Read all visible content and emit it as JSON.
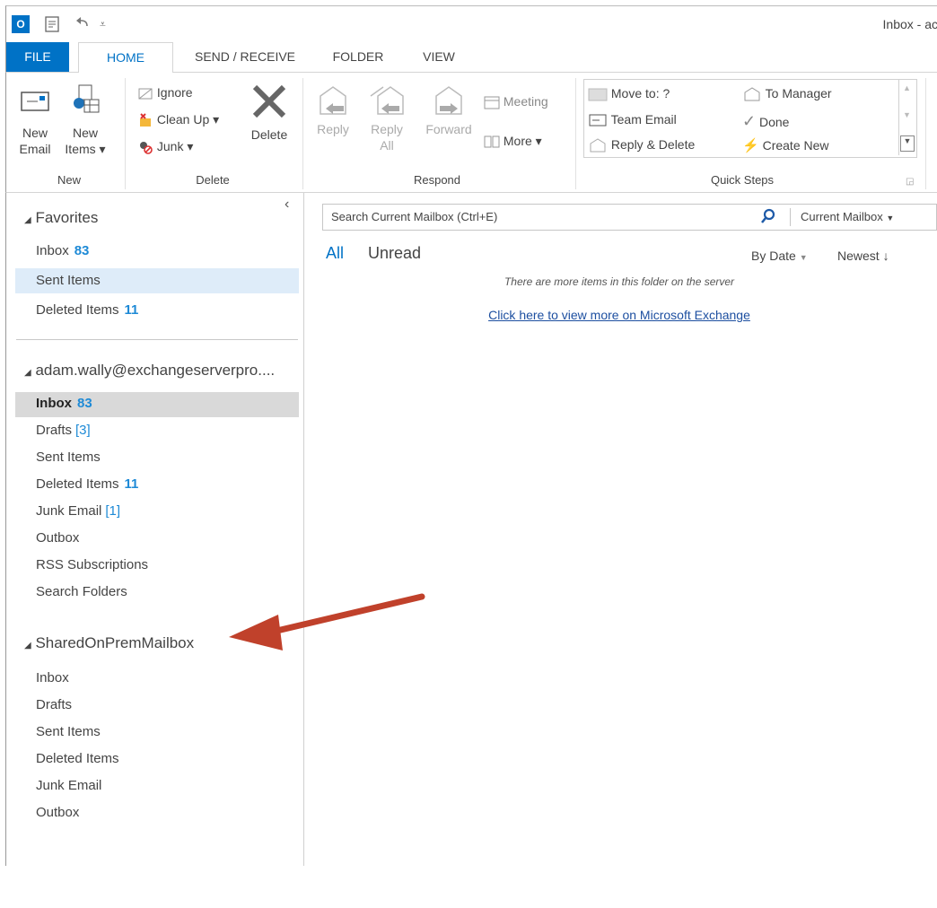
{
  "window": {
    "title": "Inbox - ac"
  },
  "quick_access": {
    "app_icon": "outlook-icon",
    "app_letter": "O",
    "send_receive_icon": "send-receive-icon",
    "undo_icon": "undo-icon",
    "customize_icon": "customize-icon"
  },
  "tabs": [
    {
      "label": "FILE"
    },
    {
      "label": "HOME"
    },
    {
      "label": "SEND / RECEIVE"
    },
    {
      "label": "FOLDER"
    },
    {
      "label": "VIEW"
    }
  ],
  "ribbon": {
    "new": {
      "new_email": "New\nEmail",
      "new_items": "New\nItems ▾",
      "group": "New"
    },
    "delete": {
      "ignore": "Ignore",
      "clean_up": "Clean Up ▾",
      "junk": "Junk ▾",
      "delete": "Delete",
      "group": "Delete"
    },
    "respond": {
      "reply": "Reply",
      "reply_all": "Reply\nAll",
      "forward": "Forward",
      "meeting": "Meeting",
      "more": "More ▾",
      "group": "Respond"
    },
    "quick_steps": {
      "move_to": "Move to: ?",
      "team_email": "Team Email",
      "reply_delete": "Reply & Delete",
      "to_manager": "To Manager",
      "done": "Done",
      "create_new": "Create New",
      "group": "Quick Steps"
    }
  },
  "sidebar": {
    "collapse_glyph": "‹",
    "favorites": {
      "label": "Favorites",
      "items": [
        {
          "label": "Inbox",
          "count": "83"
        },
        {
          "label": "Sent Items"
        },
        {
          "label": "Deleted Items",
          "count": "11"
        }
      ]
    },
    "account": {
      "label": "adam.wally@exchangeserverpro....",
      "items": [
        {
          "label": "Inbox",
          "count": "83"
        },
        {
          "label": "Drafts",
          "count": "[3]"
        },
        {
          "label": "Sent Items"
        },
        {
          "label": "Deleted Items",
          "count": "11"
        },
        {
          "label": "Junk Email",
          "count": "[1]"
        },
        {
          "label": "Outbox"
        },
        {
          "label": "RSS Subscriptions"
        },
        {
          "label": "Search Folders"
        }
      ]
    },
    "shared": {
      "label": "SharedOnPremMailbox",
      "items": [
        {
          "label": "Inbox"
        },
        {
          "label": "Drafts"
        },
        {
          "label": "Sent Items"
        },
        {
          "label": "Deleted Items"
        },
        {
          "label": "Junk Email"
        },
        {
          "label": "Outbox"
        }
      ]
    }
  },
  "main": {
    "search_placeholder": "Search Current Mailbox (Ctrl+E)",
    "search_scope": "Current Mailbox",
    "filter_all": "All",
    "filter_unread": "Unread",
    "sort_by": "By Date",
    "sort_order": "Newest",
    "server_notice": "There are more items in this folder on the server",
    "server_link": "Click here to view more on Microsoft Exchange"
  },
  "colors": {
    "accent": "#0072c6",
    "count": "#1e8ad6",
    "arrow": "#c0412b"
  }
}
